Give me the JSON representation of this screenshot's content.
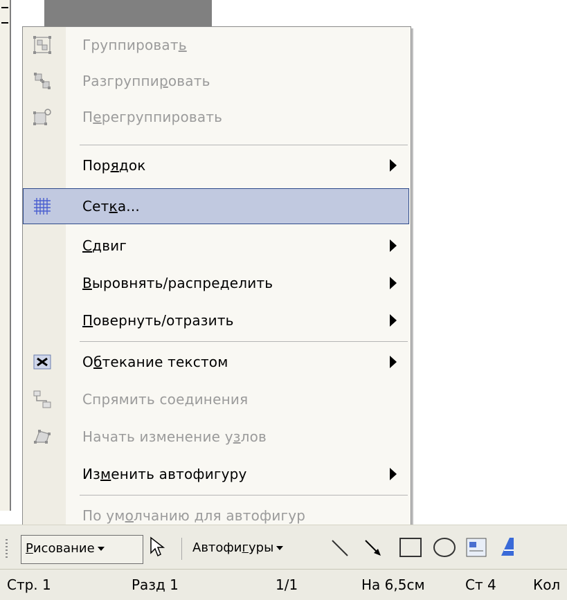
{
  "menu": {
    "items": [
      {
        "label_pre": "Группироват",
        "label_acc": "ь",
        "label_post": "",
        "disabled": true,
        "icon": "group-icon",
        "submenu": false
      },
      {
        "label_pre": "Разгруппи",
        "label_acc": "р",
        "label_post": "овать",
        "disabled": true,
        "icon": "ungroup-icon",
        "submenu": false
      },
      {
        "label_pre": "П",
        "label_acc": "е",
        "label_post": "регруппировать",
        "disabled": true,
        "icon": "regroup-icon",
        "submenu": false
      },
      {
        "label_pre": "Пор",
        "label_acc": "я",
        "label_post": "док",
        "disabled": false,
        "icon": "",
        "submenu": true
      },
      {
        "label_pre": "Сет",
        "label_acc": "к",
        "label_post": "а...",
        "disabled": false,
        "icon": "grid-icon",
        "submenu": false,
        "highlighted": true
      },
      {
        "label_pre": "",
        "label_acc": "С",
        "label_post": "двиг",
        "disabled": false,
        "icon": "",
        "submenu": true
      },
      {
        "label_pre": "",
        "label_acc": "В",
        "label_post": "ыровнять/распределить",
        "disabled": false,
        "icon": "",
        "submenu": true
      },
      {
        "label_pre": "",
        "label_acc": "П",
        "label_post": "овернуть/отразить",
        "disabled": false,
        "icon": "",
        "submenu": true
      },
      {
        "label_pre": "О",
        "label_acc": "б",
        "label_post": "текание текстом",
        "disabled": false,
        "icon": "text-wrap-icon",
        "submenu": true
      },
      {
        "label_pre": "Спрямить соединения",
        "label_acc": "",
        "label_post": "",
        "disabled": true,
        "icon": "connector-icon",
        "submenu": false
      },
      {
        "label_pre": "Начать изменение у",
        "label_acc": "з",
        "label_post": "лов",
        "disabled": true,
        "icon": "edit-points-icon",
        "submenu": false
      },
      {
        "label_pre": "Из",
        "label_acc": "м",
        "label_post": "енить автофигуру",
        "disabled": false,
        "icon": "",
        "submenu": true
      },
      {
        "label_pre": "По ум",
        "label_acc": "о",
        "label_post": "лчанию для автофигур",
        "disabled": true,
        "icon": "",
        "submenu": false
      }
    ]
  },
  "toolbar": {
    "drawing_pre": "",
    "drawing_acc": "Р",
    "drawing_post": "исование",
    "autoshapes_pre": "Автофи",
    "autoshapes_acc": "г",
    "autoshapes_post": "уры"
  },
  "statusbar": {
    "page": "Стр. 1",
    "section": "Разд 1",
    "pages": "1/1",
    "at": "На 6,5см",
    "line": "Ст 4",
    "col": "Кол"
  },
  "colors": {
    "highlight": "#c1c9e0",
    "highlight_border": "#2e4a8a",
    "disabled_text": "#9b9b9b",
    "menu_bg": "#f9f8f3",
    "gutter": "#efede4"
  }
}
